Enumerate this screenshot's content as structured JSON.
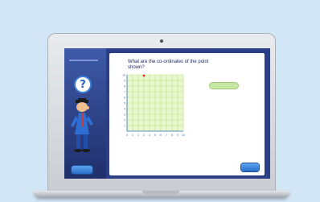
{
  "activity": {
    "question": "What are the co-ordinates of the point shown?",
    "help_icon": "question-mark-icon"
  },
  "sidebar": {
    "button_label": ""
  },
  "answer": {
    "value": "",
    "label": ""
  },
  "content": {
    "button_label": ""
  },
  "graph": {
    "x_ticks": [
      "0",
      "1",
      "2",
      "3",
      "4",
      "5",
      "6",
      "7",
      "8",
      "9",
      "10"
    ],
    "y_ticks": [
      "10",
      "9",
      "8",
      "7",
      "6",
      "5",
      "4",
      "3",
      "2",
      "1"
    ],
    "point_x": 3,
    "point_y": 10,
    "grid_color": "#b9e07a",
    "background_color": "#e9f7cf",
    "axis_color": "#2f6fc7",
    "point_color": "#d9322a"
  },
  "colors": {
    "page_background": "#d3e6f5",
    "screen_background": "#2b3f86",
    "button": "#2a6fc9"
  }
}
